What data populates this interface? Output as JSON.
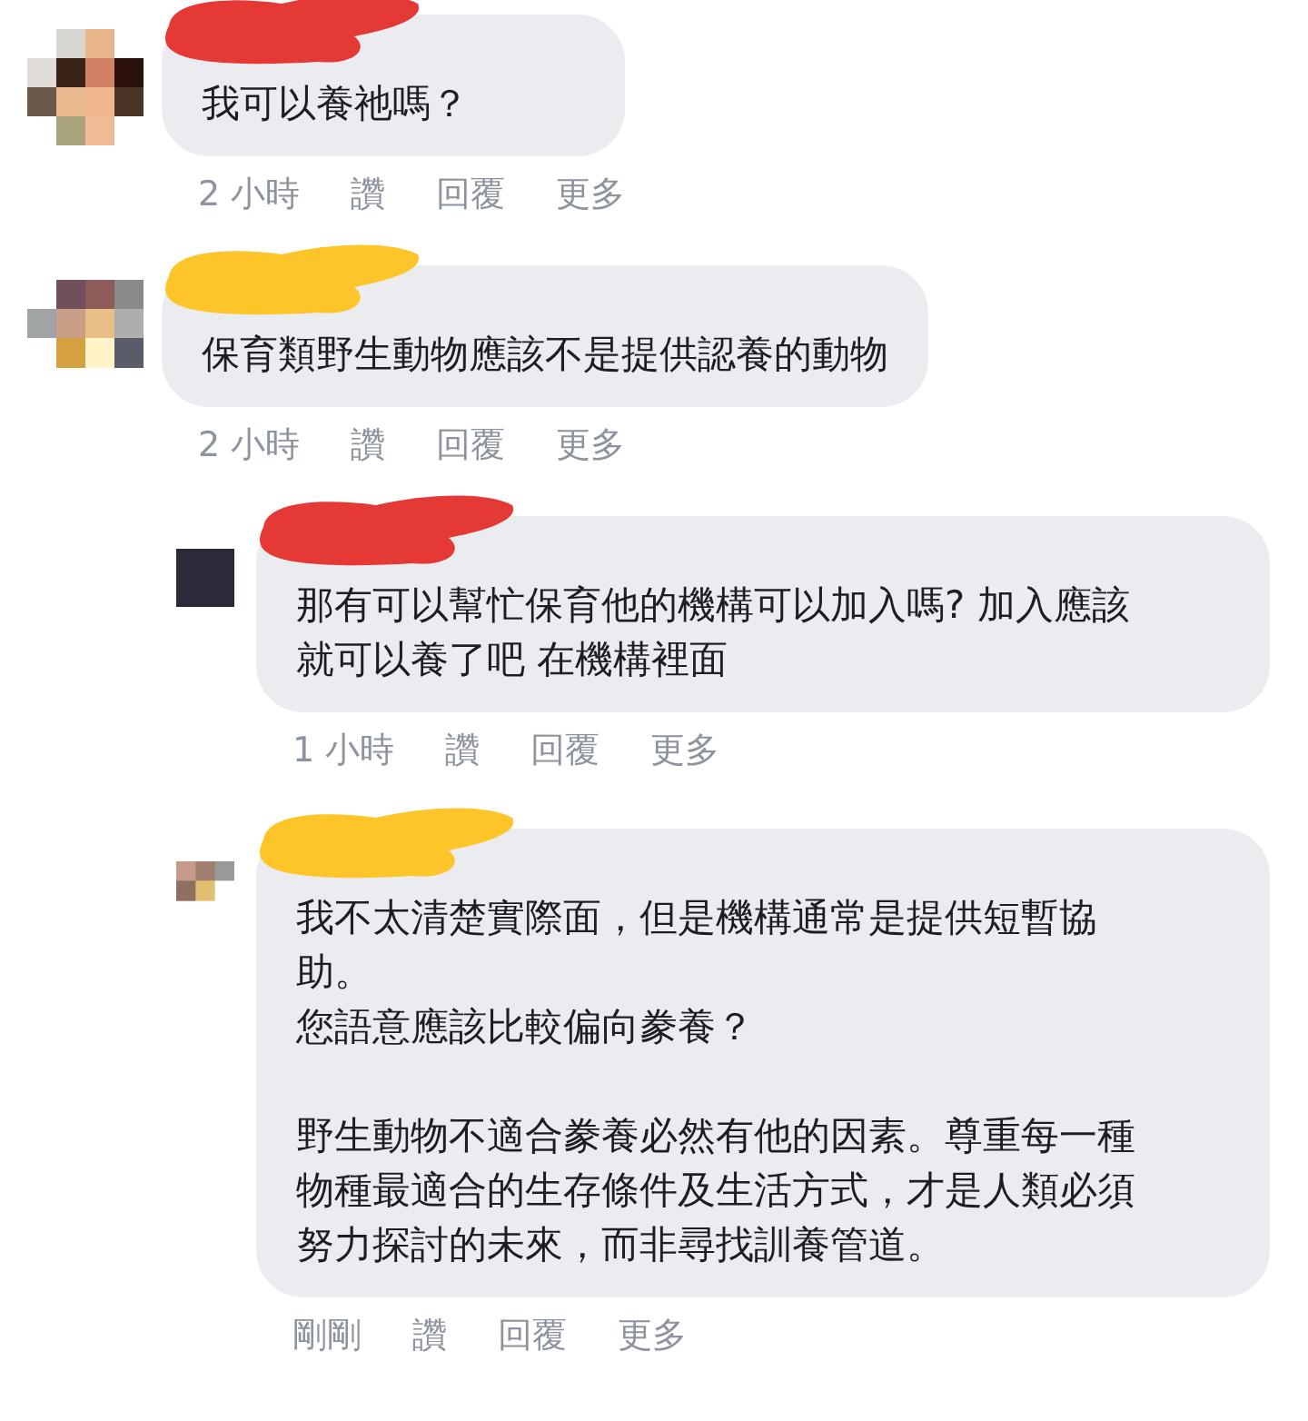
{
  "comments": [
    {
      "color": "#e53935",
      "paragraphs": [
        "我可以養祂嗎？"
      ],
      "time": "2 小時",
      "actions": [
        "讚",
        "回覆",
        "更多"
      ]
    },
    {
      "color": "#fdc52a",
      "paragraphs": [
        "保育類野生動物應該不是提供認養的動物"
      ],
      "time": "2 小時",
      "actions": [
        "讚",
        "回覆",
        "更多"
      ],
      "replies": [
        {
          "color": "#e53935",
          "paragraphs": [
            "那有可以幫忙保育他的機構可以加入嗎? 加入應該就可以養了吧 在機構裡面"
          ],
          "time": "1 小時",
          "actions": [
            "讚",
            "回覆",
            "更多"
          ]
        },
        {
          "color": "#fdc52a",
          "paragraphs": [
            "我不太清楚實際面，但是機構通常是提供短暫協助。",
            "您語意應該比較偏向豢養？",
            "野生動物不適合豢養必然有他的因素。尊重每一種物種最適合的生存條件及生活方式，才是人類必須努力探討的未來，而非尋找訓養管道。"
          ],
          "time": "剛剛",
          "actions": [
            "讚",
            "回覆",
            "更多"
          ]
        }
      ]
    }
  ]
}
